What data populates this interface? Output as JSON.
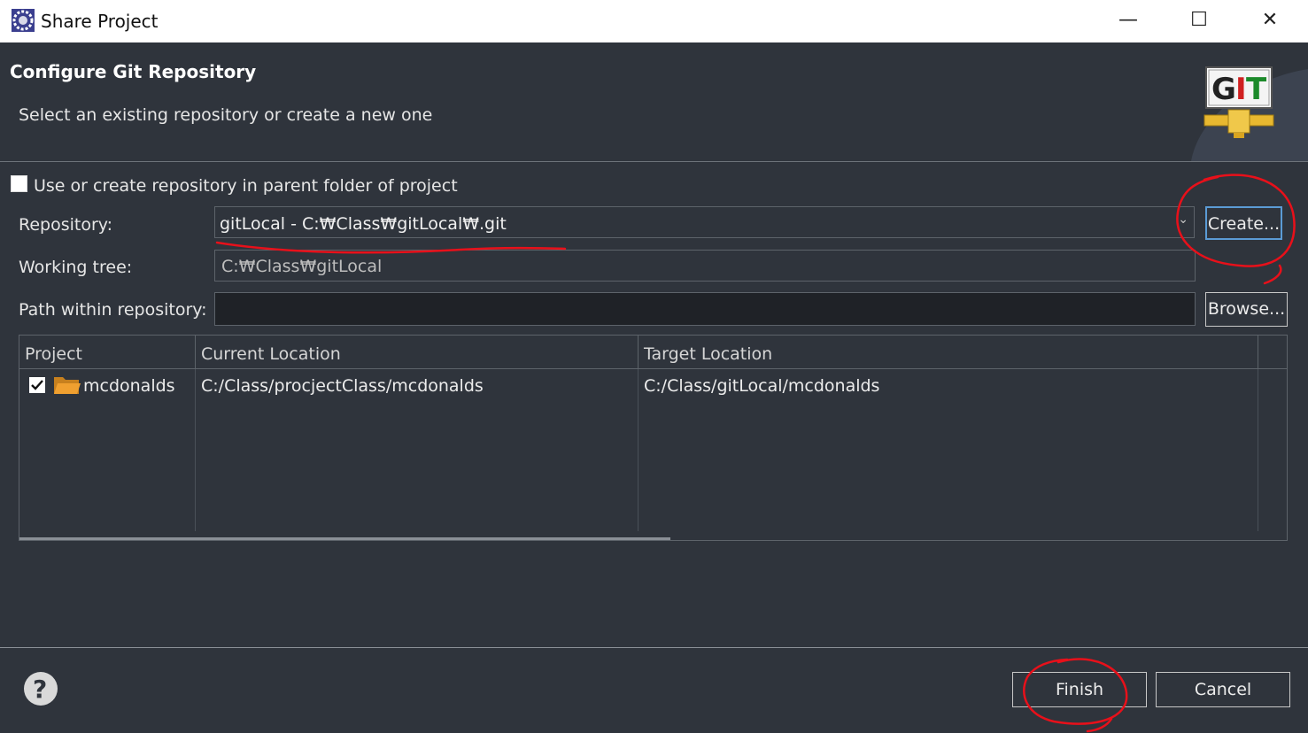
{
  "window": {
    "title": "Share Project",
    "minimize": "—",
    "maximize": "☐",
    "close": "✕"
  },
  "header": {
    "title": "Configure Git Repository",
    "description": "Select an existing repository or create a new one",
    "logo_text": "GIT"
  },
  "form": {
    "use_parent_label": "Use or create repository in parent folder of project",
    "repository_label": "Repository:",
    "repository_value": "gitLocal - C:₩Class₩gitLocal₩.git",
    "create_button": "Create...",
    "working_tree_label": "Working tree:",
    "working_tree_value": "C:₩Class₩gitLocal",
    "path_label": "Path within repository:",
    "path_value": "",
    "browse_button": "Browse..."
  },
  "table": {
    "columns": [
      "Project",
      "Current Location",
      "Target Location"
    ],
    "rows": [
      {
        "project": "mcdonalds",
        "current": "C:/Class/procjectClass/mcdonalds",
        "target": "C:/Class/gitLocal/mcdonalds",
        "checked": true
      }
    ]
  },
  "footer": {
    "finish_button": "Finish",
    "cancel_button": "Cancel"
  },
  "colors": {
    "background": "#2f343c",
    "annotation": "#e8101a"
  }
}
